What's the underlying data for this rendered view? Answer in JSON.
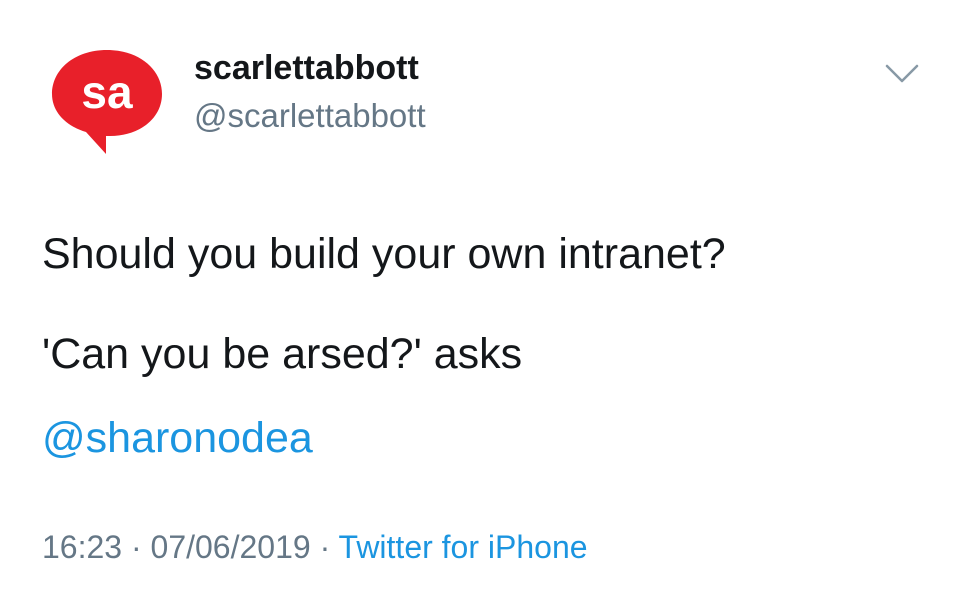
{
  "tweet": {
    "author": {
      "display_name": "scarlettabbott",
      "handle": "@scarlettabbott",
      "avatar_text": "sa",
      "avatar_color": "#e8202a"
    },
    "menu_icon": "chevron-down-icon",
    "text_line1": "Should you build your own intranet?",
    "text_line2": "'Can you be arsed?' asks",
    "mention": "@sharonodea",
    "time": "16:23",
    "separator": " · ",
    "date": "07/06/2019",
    "source": "Twitter for iPhone"
  },
  "colors": {
    "text": "#14171a",
    "secondary": "#657786",
    "link": "#1b95e0"
  }
}
